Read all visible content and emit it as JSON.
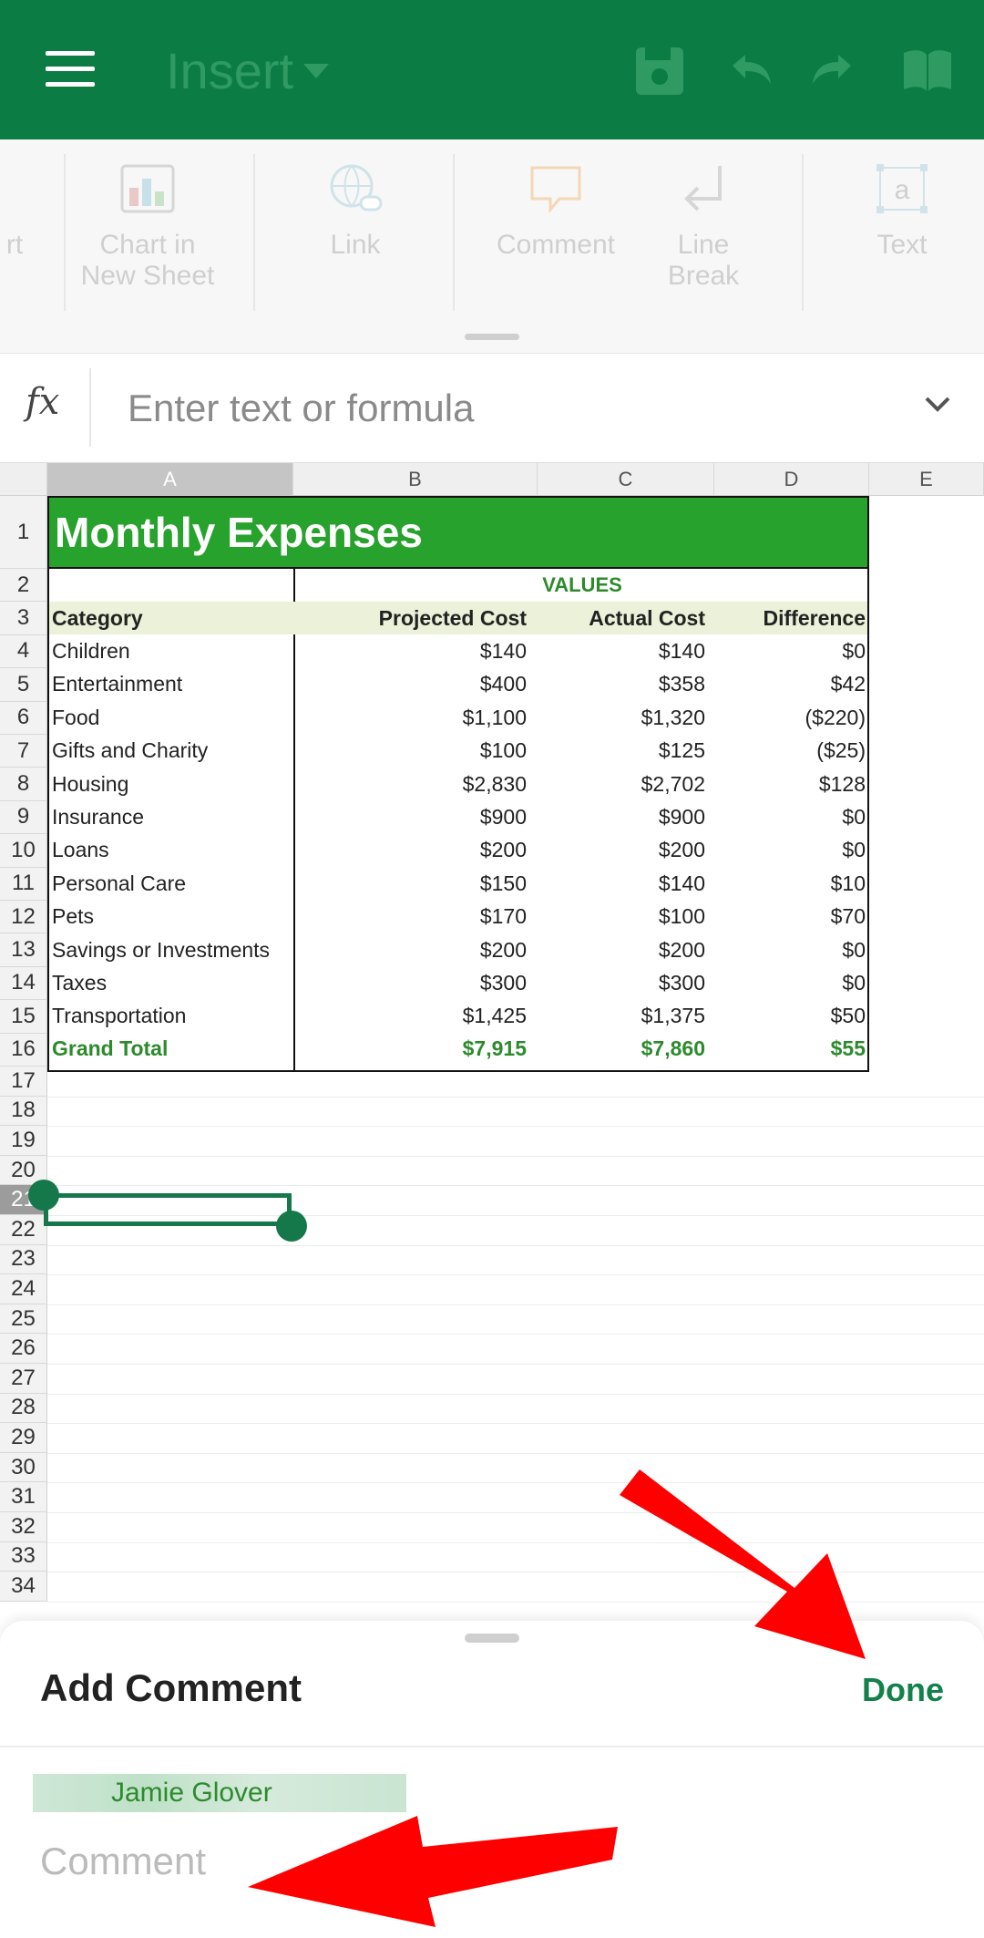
{
  "appbar": {
    "title": "Insert",
    "icons": [
      "menu-icon",
      "save-icon",
      "undo-icon",
      "redo-icon",
      "read-mode-icon"
    ]
  },
  "ribbon": {
    "items": [
      {
        "label_line1": "rt",
        "label_line2": "",
        "icon": "partial-icon"
      },
      {
        "label_line1": "Chart in",
        "label_line2": "New Sheet",
        "icon": "chart-in-new-sheet-icon"
      },
      {
        "label_line1": "Link",
        "label_line2": "",
        "icon": "link-icon"
      },
      {
        "label_line1": "Comment",
        "label_line2": "",
        "icon": "comment-icon"
      },
      {
        "label_line1": "Line",
        "label_line2": "Break",
        "icon": "line-break-icon"
      },
      {
        "label_line1": "Text",
        "label_line2": "",
        "icon": "text-box-icon"
      }
    ]
  },
  "formula_bar": {
    "fx_label": "fx",
    "placeholder": "Enter text or formula"
  },
  "sheet": {
    "columns": [
      "A",
      "B",
      "C",
      "D",
      "E"
    ],
    "rows": [
      "1",
      "2",
      "3",
      "4",
      "5",
      "6",
      "7",
      "8",
      "9",
      "10",
      "11",
      "12",
      "13",
      "14",
      "15",
      "16",
      "17",
      "18",
      "19",
      "20",
      "21",
      "22",
      "23",
      "24",
      "25",
      "26",
      "27",
      "28",
      "29",
      "30",
      "31",
      "32",
      "33",
      "34"
    ],
    "title": "Monthly Expenses",
    "values_header": "VALUES",
    "headers": [
      "Category",
      "Projected Cost",
      "Actual Cost",
      "Difference"
    ],
    "data": [
      [
        "Children",
        "$140",
        "$140",
        "$0"
      ],
      [
        "Entertainment",
        "$400",
        "$358",
        "$42"
      ],
      [
        "Food",
        "$1,100",
        "$1,320",
        "($220)"
      ],
      [
        "Gifts and Charity",
        "$100",
        "$125",
        "($25)"
      ],
      [
        "Housing",
        "$2,830",
        "$2,702",
        "$128"
      ],
      [
        "Insurance",
        "$900",
        "$900",
        "$0"
      ],
      [
        "Loans",
        "$200",
        "$200",
        "$0"
      ],
      [
        "Personal Care",
        "$150",
        "$140",
        "$10"
      ],
      [
        "Pets",
        "$170",
        "$100",
        "$70"
      ],
      [
        "Savings or Investments",
        "$200",
        "$200",
        "$0"
      ],
      [
        "Taxes",
        "$300",
        "$300",
        "$0"
      ],
      [
        "Transportation",
        "$1,425",
        "$1,375",
        "$50"
      ]
    ],
    "total": [
      "Grand Total",
      "$7,915",
      "$7,860",
      "$55"
    ],
    "selected_cell": "A21"
  },
  "comment_sheet": {
    "heading": "Add Comment",
    "done_label": "Done",
    "author": "Jamie Glover",
    "placeholder": "Comment"
  },
  "colors": {
    "appbar": "#0c7c45",
    "title_fill": "#27a22c",
    "accent": "#13814a",
    "arrow": "#ff0000"
  }
}
